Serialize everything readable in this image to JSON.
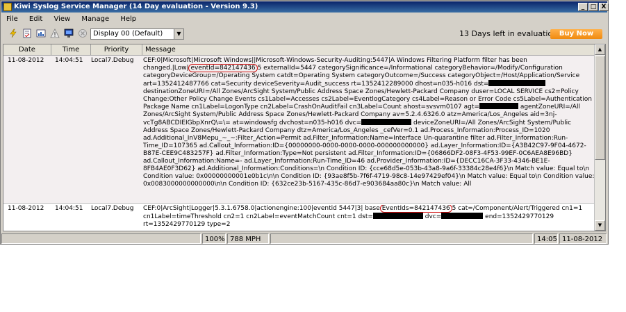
{
  "window": {
    "title": "Kiwi Syslog Service Manager (14 Day evaluation - Version 9.3)",
    "buttons": [
      "_",
      "□",
      "X"
    ]
  },
  "menu": {
    "items": [
      "File",
      "Edit",
      "View",
      "Manage",
      "Help"
    ]
  },
  "toolbar": {
    "icons": [
      "lightning-icon",
      "notepad-icon",
      "chart-icon",
      "warning-icon",
      "monitor-icon",
      "stop-icon"
    ],
    "display_select": "Display 00 (Default)",
    "evaluation_text": "13 Days left in evaluation",
    "buy_now_label": "Buy Now"
  },
  "grid": {
    "columns": [
      "Date",
      "Time",
      "Priority",
      "Message"
    ],
    "rows": [
      {
        "date": "11-08-2012",
        "time": "14:04:51",
        "priority": "Local7.Debug",
        "message": {
          "pre_highlight": "CEF:0|Microsoft|Microsoft Windows||Microsoft-Windows-Security-Auditing:5447|A Windows Filtering Platform filter has been changed.|Low|",
          "highlight": "eventId=842147436",
          "part1": "5 externalId=5447 categorySignificance=/Informational categoryBehavior=/Modify/Configuration categoryDeviceGroup=/Operating System catdt=Operating System categoryOutcome=/Success categoryObject=/Host/Application/Service art=1352412487766 cat=Security deviceSeverity=Audit_success rt=1352412289000 dhost=n035-h016 dst=",
          "part2": " destinationZoneURI=/All Zones/ArcSight System/Public Address Space Zones/Hewlett-Packard Company duser=LOCAL SERVICE cs2=Policy Change:Other Policy Change Events cs1Label=Accesses cs2Label=EventlogCategory cs4Label=Reason or Error Code cs5Label=Authentication Package Name cn1Label=LogonType cn2Label=CrashOnAuditFail cn3Label=Count ahost=svsvm0107 agt=",
          "part3": " agentZoneURI=/All Zones/ArcSight System/Public Address Space Zones/Hewlett-Packard Company av=5.2.4.6326.0 atz=America/Los_Angeles aid=3nj-vcTg8ABCDIEIGbpXnrQ\\=\\= at=windowsfg dvchost=n035-h016 dvc=",
          "part4": " deviceZoneURI=/All Zones/ArcSight System/Public Address Space Zones/Hewlett-Packard Company dtz=America/Los_Angeles _cefVer=0.1 ad.Process_Information:Process_ID=1020 ad.Additional_InV8Mepu_~_~:Filter_Action=Permit ad.Filter_Information:Name=Interface Un-quarantine filter ad.Filter_Information:Run-Time_ID=107365 ad.Callout_Information:ID={00000000-0000-0000-0000-000000000000} ad.Layer_Information:ID={A3B42C97-9F04-4672-B87E-CEE9C483257F} ad.Filter_Information:Type=Not persistent ad.Filter_Information:ID={06866DF2-08F3-4F53-99EF-0C6AEA8E96BD} ad.Callout_Information:Name=- ad.Layer_Information:Run-Time_ID=46 ad.Provider_Information:ID={DECC16CA-3F33-4346-BE1E-8FB4AE0F3D62} ad.Additional_Information:Conditions=\\n   Condition ID:    {cce68d5e-053b-43a8-9a6f-33384c28e4f6}\\n   Match value:    Equal to\\n   Condition value:    0x00000000001e0b1c\\n\\n   Condition ID:    {93ae8f5b-7f6f-4719-98c8-14e97429ef04}\\n   Match value:    Equal to\\n   Condition value:    0x0083000000000000\\n\\n   Condition ID:    {632ce23b-5167-435c-86d7-e903684aa80c}\\n   Match value:    All"
        }
      },
      {
        "date": "11-08-2012",
        "time": "14:04:51",
        "priority": "Local7.Debug",
        "message": {
          "pre_highlight": "CEF:0|ArcSight|Logger|5.3.1.6758.0|actionengine:100|eventid 5447|3| base",
          "highlight": "EventIds=842147436",
          "part1": "5 cat=/Component/Alert/Triggered cn1=1 cn1Label=timeThreshold cn2=1 cn2Label=eventMatchCount cnt=1 dst=",
          "part2": " dvc=",
          "part3": " end=1352429770129 rt=1352429770129 type=2",
          "part4": ""
        }
      }
    ]
  },
  "statusbar": {
    "zoom": "100%",
    "rate": "788 MPH",
    "time": "14:05",
    "date": "11-08-2012"
  }
}
